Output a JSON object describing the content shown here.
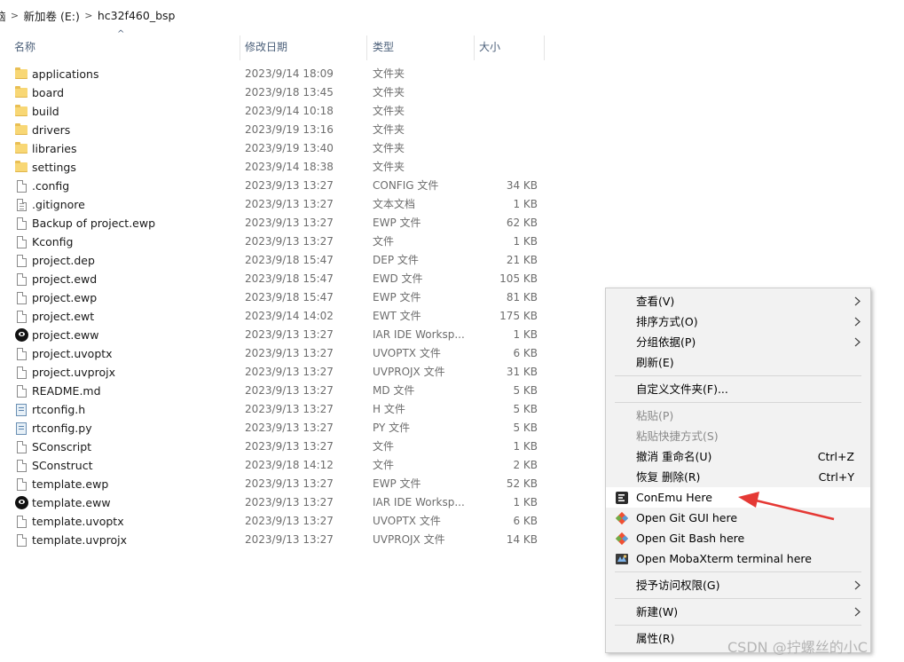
{
  "breadcrumb": {
    "items": [
      "脑",
      "新加卷 (E:)",
      "hc32f460_bsp"
    ],
    "separator": ">"
  },
  "columns": {
    "name": "名称",
    "date": "修改日期",
    "type": "类型",
    "size": "大小",
    "sort_indicator": "^"
  },
  "files": [
    {
      "icon": "folder",
      "name": "applications",
      "date": "2023/9/14 18:09",
      "type": "文件夹",
      "size": ""
    },
    {
      "icon": "folder",
      "name": "board",
      "date": "2023/9/18 13:45",
      "type": "文件夹",
      "size": ""
    },
    {
      "icon": "folder",
      "name": "build",
      "date": "2023/9/14 10:18",
      "type": "文件夹",
      "size": ""
    },
    {
      "icon": "folder",
      "name": "drivers",
      "date": "2023/9/19 13:16",
      "type": "文件夹",
      "size": ""
    },
    {
      "icon": "folder",
      "name": "libraries",
      "date": "2023/9/19 13:40",
      "type": "文件夹",
      "size": ""
    },
    {
      "icon": "folder",
      "name": "settings",
      "date": "2023/9/14 18:38",
      "type": "文件夹",
      "size": ""
    },
    {
      "icon": "file",
      "name": ".config",
      "date": "2023/9/13 13:27",
      "type": "CONFIG 文件",
      "size": "34 KB"
    },
    {
      "icon": "text-file",
      "name": ".gitignore",
      "date": "2023/9/13 13:27",
      "type": "文本文档",
      "size": "1 KB"
    },
    {
      "icon": "file",
      "name": "Backup of project.ewp",
      "date": "2023/9/13 13:27",
      "type": "EWP 文件",
      "size": "62 KB"
    },
    {
      "icon": "file",
      "name": "Kconfig",
      "date": "2023/9/13 13:27",
      "type": "文件",
      "size": "1 KB"
    },
    {
      "icon": "file",
      "name": "project.dep",
      "date": "2023/9/18 15:47",
      "type": "DEP 文件",
      "size": "21 KB"
    },
    {
      "icon": "file",
      "name": "project.ewd",
      "date": "2023/9/18 15:47",
      "type": "EWD 文件",
      "size": "105 KB"
    },
    {
      "icon": "file",
      "name": "project.ewp",
      "date": "2023/9/18 15:47",
      "type": "EWP 文件",
      "size": "81 KB"
    },
    {
      "icon": "file",
      "name": "project.ewt",
      "date": "2023/9/14 14:02",
      "type": "EWT 文件",
      "size": "175 KB"
    },
    {
      "icon": "iar",
      "name": "project.eww",
      "date": "2023/9/13 13:27",
      "type": "IAR IDE Worksp...",
      "size": "1 KB"
    },
    {
      "icon": "file",
      "name": "project.uvoptx",
      "date": "2023/9/13 13:27",
      "type": "UVOPTX 文件",
      "size": "6 KB"
    },
    {
      "icon": "file",
      "name": "project.uvprojx",
      "date": "2023/9/13 13:27",
      "type": "UVPROJX 文件",
      "size": "31 KB"
    },
    {
      "icon": "file",
      "name": "README.md",
      "date": "2023/9/13 13:27",
      "type": "MD 文件",
      "size": "5 KB"
    },
    {
      "icon": "code-file",
      "name": "rtconfig.h",
      "date": "2023/9/13 13:27",
      "type": "H 文件",
      "size": "5 KB"
    },
    {
      "icon": "code-file",
      "name": "rtconfig.py",
      "date": "2023/9/13 13:27",
      "type": "PY 文件",
      "size": "5 KB"
    },
    {
      "icon": "file",
      "name": "SConscript",
      "date": "2023/9/13 13:27",
      "type": "文件",
      "size": "1 KB"
    },
    {
      "icon": "file",
      "name": "SConstruct",
      "date": "2023/9/18 14:12",
      "type": "文件",
      "size": "2 KB"
    },
    {
      "icon": "file",
      "name": "template.ewp",
      "date": "2023/9/13 13:27",
      "type": "EWP 文件",
      "size": "52 KB"
    },
    {
      "icon": "iar",
      "name": "template.eww",
      "date": "2023/9/13 13:27",
      "type": "IAR IDE Worksp...",
      "size": "1 KB"
    },
    {
      "icon": "file",
      "name": "template.uvoptx",
      "date": "2023/9/13 13:27",
      "type": "UVOPTX 文件",
      "size": "6 KB"
    },
    {
      "icon": "file",
      "name": "template.uvprojx",
      "date": "2023/9/13 13:27",
      "type": "UVPROJX 文件",
      "size": "14 KB"
    }
  ],
  "context_menu": {
    "items": [
      {
        "id": "view",
        "label": "查看(V)",
        "submenu": true
      },
      {
        "id": "sort",
        "label": "排序方式(O)",
        "submenu": true
      },
      {
        "id": "group",
        "label": "分组依据(P)",
        "submenu": true
      },
      {
        "id": "refresh",
        "label": "刷新(E)"
      },
      {
        "id": "customize",
        "label": "自定义文件夹(F)..."
      },
      {
        "id": "paste",
        "label": "粘贴(P)",
        "disabled": true
      },
      {
        "id": "paste-shortcut",
        "label": "粘贴快捷方式(S)",
        "disabled": true
      },
      {
        "id": "undo-rename",
        "label": "撤消 重命名(U)",
        "accelerator": "Ctrl+Z"
      },
      {
        "id": "redo-delete",
        "label": "恢复 删除(R)",
        "accelerator": "Ctrl+Y"
      },
      {
        "id": "conemu",
        "label": "ConEmu Here",
        "icon": "conemu-icon",
        "highlighted": true
      },
      {
        "id": "git-gui",
        "label": "Open Git GUI here",
        "icon": "git-icon"
      },
      {
        "id": "git-bash",
        "label": "Open Git Bash here",
        "icon": "git-icon"
      },
      {
        "id": "mobaxterm",
        "label": "Open MobaXterm terminal here",
        "icon": "mobaxterm-icon"
      },
      {
        "id": "grant-access",
        "label": "授予访问权限(G)",
        "submenu": true
      },
      {
        "id": "new",
        "label": "新建(W)",
        "submenu": true
      },
      {
        "id": "properties",
        "label": "属性(R)"
      }
    ]
  },
  "annotation": {
    "arrow_color": "#e53935"
  },
  "watermark": "CSDN @拧螺丝的小C"
}
